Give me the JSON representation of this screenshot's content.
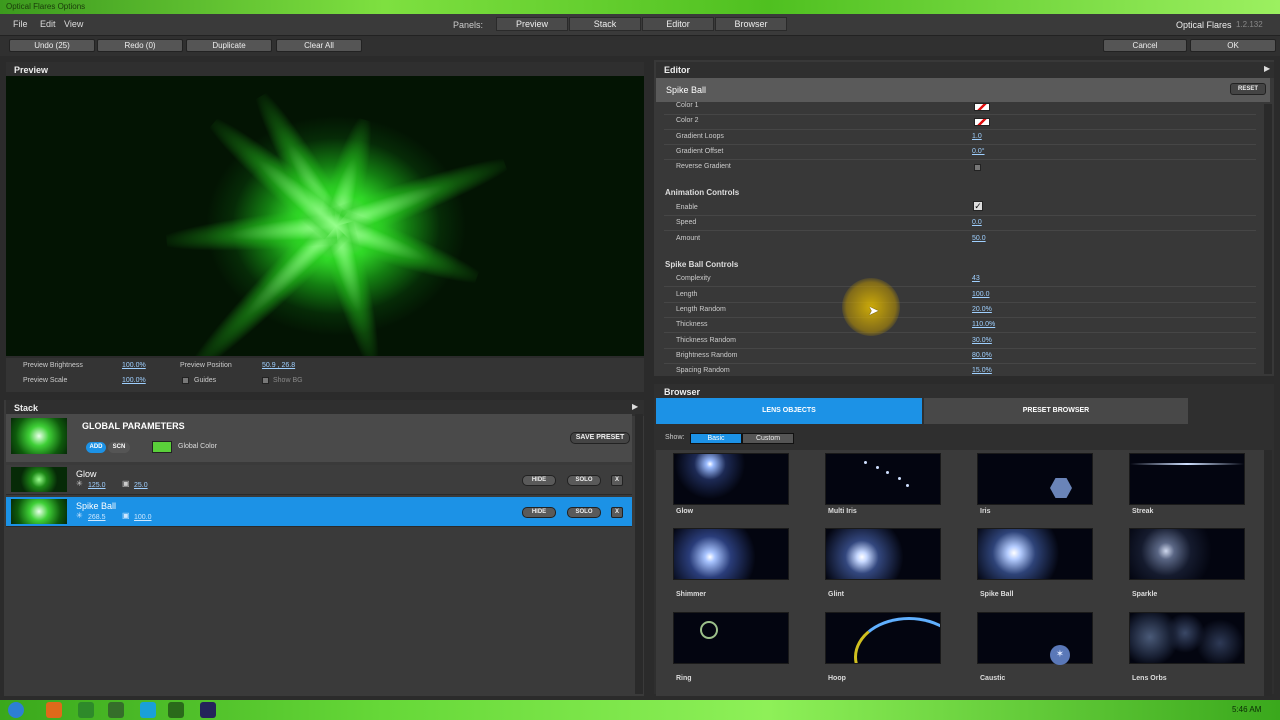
{
  "window": {
    "title": "Optical Flares Options"
  },
  "menu": [
    "File",
    "Edit",
    "View"
  ],
  "panels": {
    "label": "Panels:",
    "tabs": [
      "Preview",
      "Stack",
      "Editor",
      "Browser"
    ]
  },
  "app": {
    "name": "Optical Flares",
    "version": "1.2.132"
  },
  "toolbar": {
    "undo": "Undo (25)",
    "redo": "Redo (0)",
    "duplicate": "Duplicate",
    "clear_all": "Clear All",
    "cancel": "Cancel",
    "ok": "OK"
  },
  "preview": {
    "title": "Preview",
    "brightness_label": "Preview Brightness",
    "brightness": "100.0%",
    "scale_label": "Preview Scale",
    "scale": "100.0%",
    "position_label": "Preview Position",
    "position": "50.9 , 26.8",
    "guides": "Guides",
    "show_bg": "Show BG"
  },
  "stack": {
    "title": "Stack",
    "global_title": "GLOBAL PARAMETERS",
    "add": "ADD",
    "scn": "SCN",
    "global_color_label": "Global Color",
    "global_color": "#5ad03a",
    "save_preset": "SAVE PRESET",
    "layers": [
      {
        "name": "Glow",
        "v1": "125.0",
        "v2": "25.0",
        "selected": false
      },
      {
        "name": "Spike Ball",
        "v1": "268.5",
        "v2": "100.0",
        "selected": true
      }
    ],
    "hide": "HIDE",
    "solo": "SOLO",
    "x": "X"
  },
  "editor": {
    "title": "Editor",
    "object": "Spike Ball",
    "reset": "RESET",
    "gradient": [
      {
        "label": "Color 1",
        "type": "swatch"
      },
      {
        "label": "Color 2",
        "type": "swatch"
      },
      {
        "label": "Gradient Loops",
        "value": "1.0"
      },
      {
        "label": "Gradient Offset",
        "value": "0.0°"
      },
      {
        "label": "Reverse Gradient",
        "type": "checkbox"
      }
    ],
    "animation_title": "Animation Controls",
    "animation": [
      {
        "label": "Enable",
        "type": "check"
      },
      {
        "label": "Speed",
        "value": "0.0"
      },
      {
        "label": "Amount",
        "value": "50.0"
      }
    ],
    "spike_title": "Spike Ball Controls",
    "spike": [
      {
        "label": "Complexity",
        "value": "43"
      },
      {
        "label": "Length",
        "value": "100.0"
      },
      {
        "label": "Length Random",
        "value": "20.0%"
      },
      {
        "label": "Thickness",
        "value": "110.0%"
      },
      {
        "label": "Thickness Random",
        "value": "30.0%"
      },
      {
        "label": "Brightness Random",
        "value": "80.0%"
      },
      {
        "label": "Spacing Random",
        "value": "15.0%"
      }
    ]
  },
  "browser": {
    "title": "Browser",
    "tab_lens": "LENS OBJECTS",
    "tab_preset": "PRESET BROWSER",
    "show_label": "Show:",
    "basic": "Basic",
    "custom": "Custom",
    "objects": [
      "Glow",
      "Multi Iris",
      "Iris",
      "Streak",
      "Shimmer",
      "Glint",
      "Spike Ball",
      "Sparkle",
      "Ring",
      "Hoop",
      "Caustic",
      "Lens Orbs"
    ]
  },
  "taskbar": {
    "time": "5:46 AM"
  }
}
